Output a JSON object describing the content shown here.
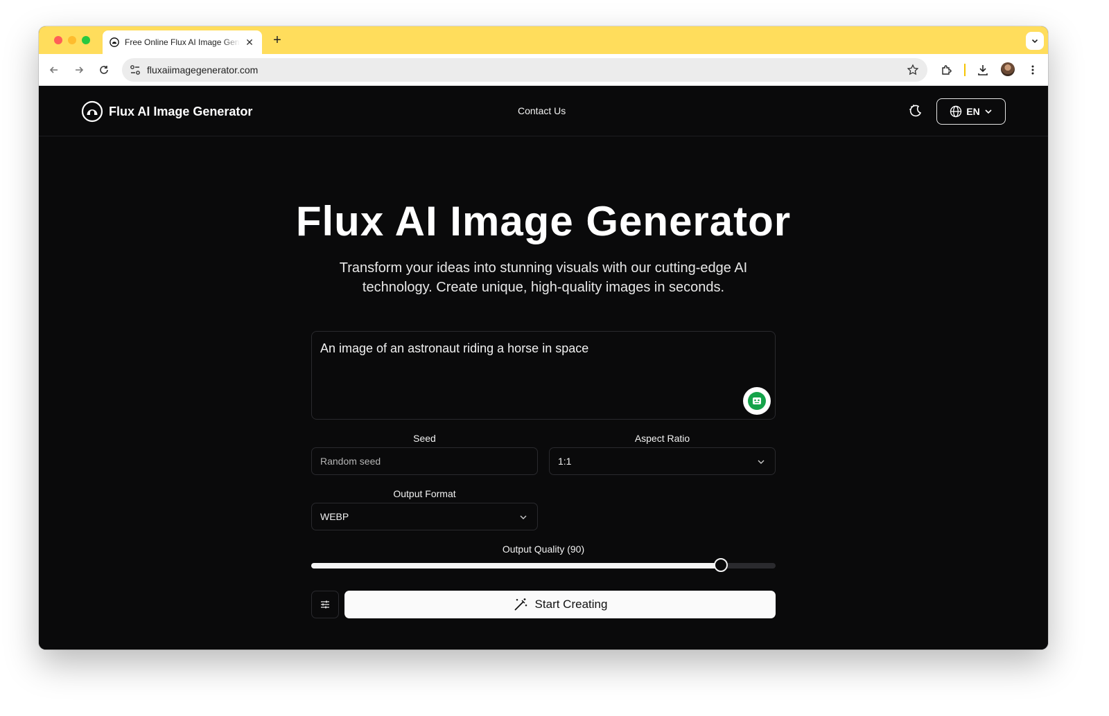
{
  "browser": {
    "tab_title": "Free Online Flux AI Image Generator",
    "new_tab_symbol": "+",
    "close_symbol": "✕",
    "url": "fluxaiimagegenerator.com"
  },
  "site": {
    "brand_name": "Flux AI Image Generator",
    "nav_links": [
      "Contact Us"
    ],
    "language": "EN"
  },
  "hero": {
    "title": "Flux AI Image Generator",
    "subtitle": "Transform your ideas into stunning visuals with our cutting-edge AI technology. Create unique, high-quality images in seconds."
  },
  "form": {
    "prompt_value": "An image of an astronaut riding a horse in space",
    "seed_label": "Seed",
    "seed_placeholder": "Random seed",
    "aspect_label": "Aspect Ratio",
    "aspect_value": "1:1",
    "format_label": "Output Format",
    "format_value": "WEBP",
    "quality_label": "Output Quality (90)",
    "quality_value": 90,
    "quality_max": 100,
    "submit_label": "Start Creating"
  },
  "colors": {
    "page_bg": "#0a0a0b",
    "tabstrip_bg": "#ffdd5c",
    "button_bg": "#fafafa",
    "grammarly_green": "#15a34a"
  }
}
